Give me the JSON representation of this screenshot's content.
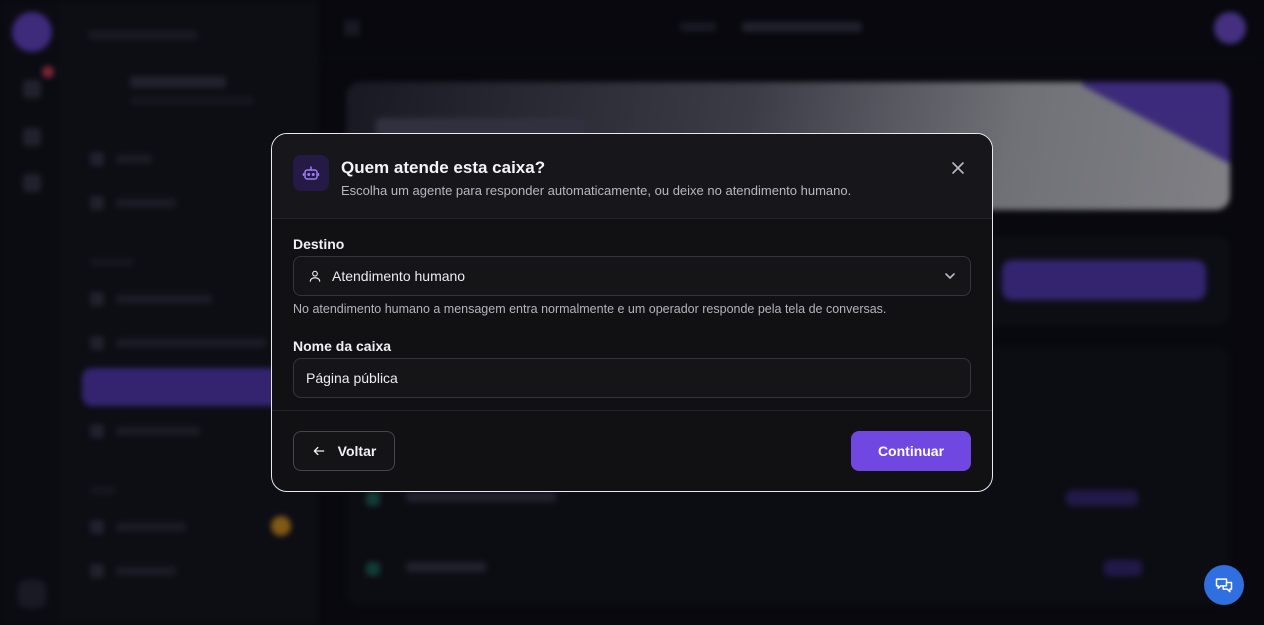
{
  "colors": {
    "accent": "#7047e0",
    "fab": "#2f6fe0",
    "modal_bg": "#111114",
    "modal_border": "#e9e9ef"
  },
  "modal": {
    "icon": "bot-icon",
    "title": "Quem atende esta caixa?",
    "subtitle": "Escolha um agente para responder automaticamente, ou deixe no atendimento humano.",
    "close_icon": "close-icon",
    "destination": {
      "label": "Destino",
      "selected_icon": "user-icon",
      "selected_value": "Atendimento humano",
      "hint": "No atendimento humano a mensagem entra normalmente e um operador responde pela tela de conversas."
    },
    "box_name": {
      "label": "Nome da caixa",
      "value": "Página pública"
    },
    "back_button": "Voltar",
    "continue_button": "Continuar"
  },
  "fab": {
    "icon": "chat-icon"
  }
}
